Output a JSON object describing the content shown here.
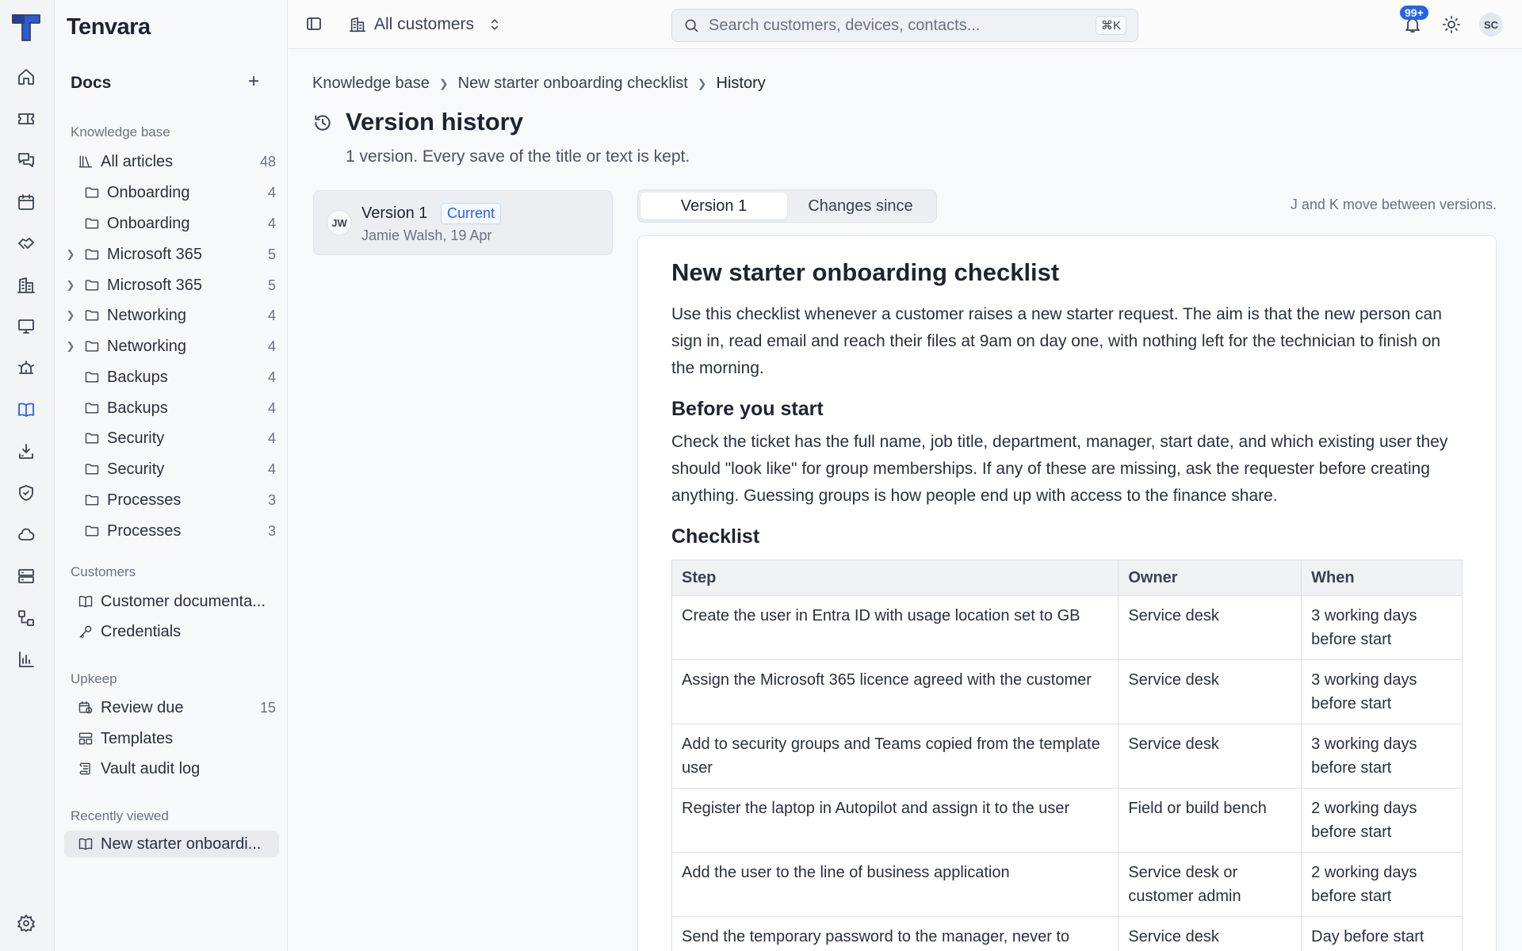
{
  "app": {
    "name": "Tenvara"
  },
  "rail": {
    "items": [
      {
        "icon": "home-icon"
      },
      {
        "icon": "ticket-icon"
      },
      {
        "icon": "chat-icon"
      },
      {
        "icon": "calendar-icon"
      },
      {
        "icon": "handshake-icon"
      },
      {
        "icon": "building-icon"
      },
      {
        "icon": "monitor-icon"
      },
      {
        "icon": "alarm-icon"
      },
      {
        "icon": "book-icon",
        "active": true
      },
      {
        "icon": "download-icon"
      },
      {
        "icon": "shield-icon"
      },
      {
        "icon": "cloud-icon"
      },
      {
        "icon": "server-icon"
      },
      {
        "icon": "workflow-icon"
      },
      {
        "icon": "chart-icon"
      },
      {
        "icon": "settings-icon"
      }
    ]
  },
  "sidebar": {
    "title": "Docs",
    "knowledge_base": {
      "label": "Knowledge base",
      "all_articles": {
        "label": "All articles",
        "count": "48"
      },
      "folders": [
        {
          "label": "Onboarding",
          "count": "4",
          "expandable": false
        },
        {
          "label": "Onboarding",
          "count": "4",
          "expandable": false
        },
        {
          "label": "Microsoft 365",
          "count": "5",
          "expandable": true
        },
        {
          "label": "Microsoft 365",
          "count": "5",
          "expandable": true
        },
        {
          "label": "Networking",
          "count": "4",
          "expandable": true
        },
        {
          "label": "Networking",
          "count": "4",
          "expandable": true
        },
        {
          "label": "Backups",
          "count": "4",
          "expandable": false
        },
        {
          "label": "Backups",
          "count": "4",
          "expandable": false
        },
        {
          "label": "Security",
          "count": "4",
          "expandable": false
        },
        {
          "label": "Security",
          "count": "4",
          "expandable": false
        },
        {
          "label": "Processes",
          "count": "3",
          "expandable": false
        },
        {
          "label": "Processes",
          "count": "3",
          "expandable": false
        }
      ]
    },
    "customers": {
      "label": "Customers",
      "items": [
        {
          "label": "Customer documenta..."
        },
        {
          "label": "Credentials"
        }
      ]
    },
    "upkeep": {
      "label": "Upkeep",
      "items": [
        {
          "label": "Review due",
          "count": "15"
        },
        {
          "label": "Templates",
          "count": ""
        },
        {
          "label": "Vault audit log",
          "count": ""
        }
      ]
    },
    "recent": {
      "label": "Recently viewed",
      "items": [
        {
          "label": "New starter onboardi..."
        }
      ]
    }
  },
  "topbar": {
    "customer_selector": "All customers",
    "search_placeholder": "Search customers, devices, contacts...",
    "search_shortcut": "⌘K",
    "notifications_badge": "99+",
    "user_initials": "SC"
  },
  "breadcrumb": [
    "Knowledge base",
    "New starter onboarding checklist",
    "History"
  ],
  "page": {
    "title": "Version history",
    "subtitle": "1 version. Every save of the title or text is kept."
  },
  "versions": [
    {
      "initials": "JW",
      "name": "Version 1",
      "badge": "Current",
      "meta": "Jamie Walsh, 19 Apr"
    }
  ],
  "view_toggle": {
    "options": [
      "Version 1",
      "Changes since"
    ],
    "selected": "Version 1"
  },
  "hint": "J and K move between versions.",
  "document": {
    "title": "New starter onboarding checklist",
    "intro": "Use this checklist whenever a customer raises a new starter request. The aim is that the new person can sign in, read email and reach their files at 9am on day one, with nothing left for the technician to finish on the morning.",
    "section1_heading": "Before you start",
    "section1_body": "Check the ticket has the full name, job title, department, manager, start date, and which existing user they should \"look like\" for group memberships. If any of these are missing, ask the requester before creating anything. Guessing groups is how people end up with access to the finance share.",
    "section2_heading": "Checklist",
    "table": {
      "headers": [
        "Step",
        "Owner",
        "When"
      ],
      "rows": [
        [
          "Create the user in Entra ID with usage location set to GB",
          "Service desk",
          "3 working days before start"
        ],
        [
          "Assign the Microsoft 365 licence agreed with the customer",
          "Service desk",
          "3 working days before start"
        ],
        [
          "Add to security groups and Teams copied from the template user",
          "Service desk",
          "3 working days before start"
        ],
        [
          "Register the laptop in Autopilot and assign it to the user",
          "Field or build bench",
          "2 working days before start"
        ],
        [
          "Add the user to the line of business application",
          "Service desk or customer admin",
          "2 working days before start"
        ],
        [
          "Send the temporary password to the manager, never to",
          "Service desk",
          "Day before start"
        ]
      ]
    }
  }
}
